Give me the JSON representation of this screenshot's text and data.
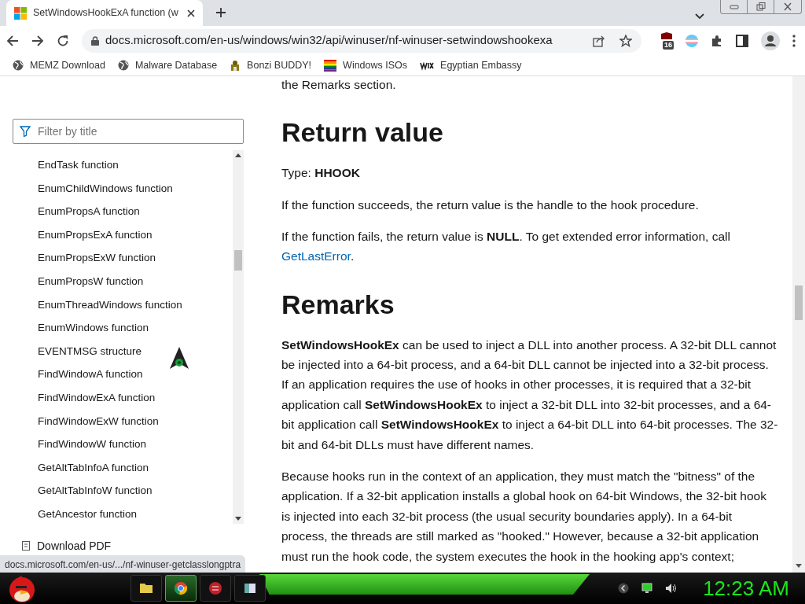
{
  "browser": {
    "tab": {
      "title": "SetWindowsHookExA function (w"
    },
    "url": "docs.microsoft.com/en-us/windows/win32/api/winuser/nf-winuser-setwindowshookexa",
    "extension_badge": "16",
    "bookmarks": [
      {
        "label": "MEMZ Download",
        "kind": "globe"
      },
      {
        "label": "Malware Database",
        "kind": "globe"
      },
      {
        "label": "Bonzi BUDDY!",
        "kind": "figure"
      },
      {
        "label": "Windows ISOs",
        "kind": "rainbow"
      },
      {
        "label": "Egyptian Embassy",
        "kind": "wix"
      }
    ]
  },
  "sidebar": {
    "filter": {
      "placeholder": "Filter by title"
    },
    "items": [
      "EndTask function",
      "EnumChildWindows function",
      "EnumPropsA function",
      "EnumPropsExA function",
      "EnumPropsExW function",
      "EnumPropsW function",
      "EnumThreadWindows function",
      "EnumWindows function",
      "EVENTMSG structure",
      "FindWindowA function",
      "FindWindowExA function",
      "FindWindowExW function",
      "FindWindowW function",
      "GetAltTabInfoA function",
      "GetAltTabInfoW function",
      "GetAncestor function"
    ],
    "download": "Download PDF"
  },
  "article": {
    "intro": "the Remarks section.",
    "sections": [
      {
        "heading": "Return value",
        "paragraphs": [
          [
            {
              "text": "Type: **HHOOK**"
            }
          ],
          [
            {
              "text": "If the function succeeds, the return value is the handle to the hook procedure."
            }
          ],
          [
            {
              "text": "If the function fails, the return value is **NULL**. To get extended error information, call "
            },
            {
              "link": "GetLastError"
            },
            {
              "text": "."
            }
          ]
        ]
      },
      {
        "heading": "Remarks",
        "paragraphs": [
          [
            {
              "text": "**SetWindowsHookEx** can be used to inject a DLL into another process. A 32-bit DLL cannot be injected into a 64-bit process, and a 64-bit DLL cannot be injected into a 32-bit process. If an application requires the use of hooks in other processes, it is required that a 32-bit application call **SetWindowsHookEx** to inject a 32-bit DLL into 32-bit processes, and a 64-bit application call **SetWindowsHookEx** to inject a 64-bit DLL into 64-bit processes. The 32-bit and 64-bit DLLs must have different names."
            }
          ],
          [
            {
              "text": "Because hooks run in the context of an application, they must match the \"bitness\" of the application. If a 32-bit application installs a global hook on 64-bit Windows, the 32-bit hook is injected into each 32-bit process (the usual security boundaries apply). In a 64-bit process, the threads are still marked as \"hooked.\" However, because a 32-bit application must run the hook code, the system executes the hook in the hooking app's context;"
            }
          ]
        ]
      }
    ]
  },
  "status_url": "docs.microsoft.com/en-us/.../nf-winuser-getclasslongptra",
  "taskbar": {
    "apps": [
      {
        "kind": "folder",
        "selected": false
      },
      {
        "kind": "chrome",
        "selected": true
      },
      {
        "kind": "devcpp",
        "selected": false
      },
      {
        "kind": "window",
        "selected": false
      }
    ],
    "clock": "12:23 AM"
  }
}
